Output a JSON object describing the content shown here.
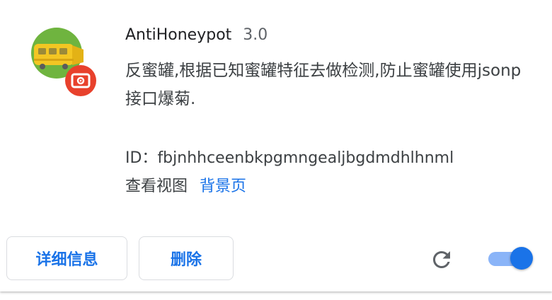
{
  "extension": {
    "name": "AntiHoneypot",
    "version": "3.0",
    "description": "反蜜罐,根据已知蜜罐特征去做检测,防止蜜罐使用jsonp接口爆菊.",
    "id_label": "ID：",
    "id_value": "fbjnhhceenbkpgmngealjbgdmdhlhnml",
    "inspect_views_label": "查看视图",
    "inspect_link": "背景页",
    "icon": "train-icon",
    "badge_icon": "cassette-icon"
  },
  "actions": {
    "details_label": "详细信息",
    "remove_label": "删除",
    "reload_icon": "reload-icon",
    "enabled": true
  },
  "colors": {
    "accent": "#1a73e8",
    "toggle_track": "#8ab4f8",
    "icon_green": "#6fb43f",
    "icon_train": "#f3c623",
    "badge_red": "#e8412c",
    "text_primary": "#202124",
    "text_secondary": "#5f6368"
  }
}
